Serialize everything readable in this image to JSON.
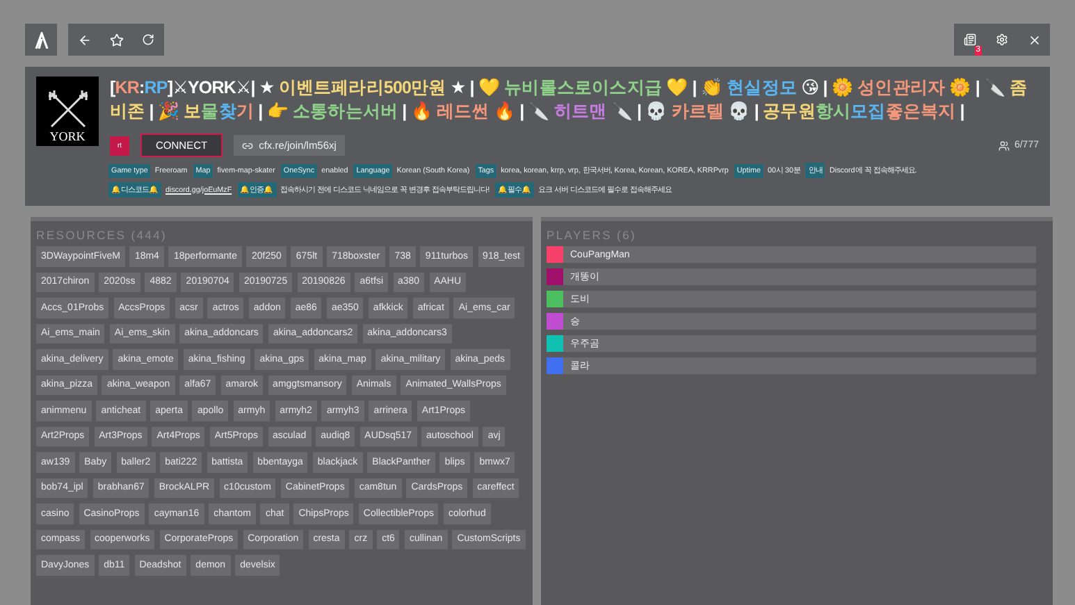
{
  "toolbar": {
    "notification_count": "3"
  },
  "server": {
    "logo_text": "YORK",
    "title": [
      {
        "text": "[",
        "color": "#ffffff"
      },
      {
        "text": "KR",
        "color": "#f4967a"
      },
      {
        "text": ":",
        "color": "#ffffff"
      },
      {
        "text": "RP",
        "color": "#5ab4f0"
      },
      {
        "text": "]⚔YORK⚔| ★ ",
        "color": "#ffffff"
      },
      {
        "text": "이벤트페라리500만원",
        "color": "#f5d77a"
      },
      {
        "text": " ★ | 💛 ",
        "color": "#ffffff"
      },
      {
        "text": "뉴비롤스로이스지급",
        "color": "#8fd18a"
      },
      {
        "text": " 💛 | 👏 ",
        "color": "#ffffff"
      },
      {
        "text": "현실정모",
        "color": "#5ab4f0"
      },
      {
        "text": " 😘 | 🌼 ",
        "color": "#ffffff"
      },
      {
        "text": "성인관리자",
        "color": "#f4967a"
      },
      {
        "text": " 🌼 | 🔪 ",
        "color": "#ffffff"
      },
      {
        "text": "좀비존",
        "color": "#f5d77a"
      },
      {
        "text": " | 🎉 ",
        "color": "#ffffff"
      },
      {
        "text": "보",
        "color": "#f5d77a"
      },
      {
        "text": "물",
        "color": "#8fd18a"
      },
      {
        "text": "찾",
        "color": "#5ab4f0"
      },
      {
        "text": "기",
        "color": "#f4967a"
      },
      {
        "text": " | 👉 ",
        "color": "#ffffff"
      },
      {
        "text": "소통하는서버",
        "color": "#8fd18a"
      },
      {
        "text": " | 🔥 ",
        "color": "#ffffff"
      },
      {
        "text": "레드썬",
        "color": "#f4967a"
      },
      {
        "text": " 🔥 | 🔪 ",
        "color": "#ffffff"
      },
      {
        "text": "히트맨",
        "color": "#c77ce0"
      },
      {
        "text": " 🔪 | 💀 ",
        "color": "#ffffff"
      },
      {
        "text": "카르텔",
        "color": "#f4967a"
      },
      {
        "text": " 💀 | ",
        "color": "#ffffff"
      },
      {
        "text": "공무원",
        "color": "#f5d77a"
      },
      {
        "text": "항시",
        "color": "#8fd18a"
      },
      {
        "text": "모집",
        "color": "#5ab4f0"
      },
      {
        "text": "좋은복지",
        "color": "#f4967a"
      },
      {
        "text": " |",
        "color": "#ffffff"
      }
    ],
    "badge": "rt",
    "connect": "CONNECT",
    "join_link": "cfx.re/join/lm56xj",
    "players_count": "6/777",
    "vars": [
      {
        "key": "Game type",
        "value": "Freeroam"
      },
      {
        "key": "Map",
        "value": "fivem-map-skater"
      },
      {
        "key": "OneSync",
        "value": "enabled"
      },
      {
        "key": "Language",
        "value": "Korean (South Korea)"
      },
      {
        "key": "Tags",
        "value": "korea, korean, krrp, vrp, 한국서버, Korea, Korean, KOREA, KRRPvrp"
      },
      {
        "key": "Uptime",
        "value": "00시 30분"
      },
      {
        "key": "안내",
        "value": "Discord에 꼭 접속해주세요."
      },
      {
        "key": "🔔디스코드🔔",
        "value": "discord.gg/joEuMzF"
      },
      {
        "key": "🔔인증🔔",
        "value": "접속하시기 전에 디스코드 닉네임으로 꼭 변경후 접속부탁드립니다!"
      },
      {
        "key": "🔔필수🔔",
        "value": "요크 서버 디스코드에 필수로 접속해주세요"
      }
    ]
  },
  "resources": {
    "title": "RESOURCES (444)",
    "items": [
      "3DWaypointFiveM",
      "18m4",
      "18performante",
      "20f250",
      "675lt",
      "718boxster",
      "738",
      "911turbos",
      "918_test",
      "2017chiron",
      "2020ss",
      "4882",
      "20190704",
      "20190725",
      "20190826",
      "a6tfsi",
      "a380",
      "AAHU",
      "Accs_01Probs",
      "AccsProps",
      "acsr",
      "actros",
      "addon",
      "ae86",
      "ae350",
      "afkkick",
      "africat",
      "Ai_ems_car",
      "Ai_ems_main",
      "Ai_ems_skin",
      "akina_addoncars",
      "akina_addoncars2",
      "akina_addoncars3",
      "akina_delivery",
      "akina_emote",
      "akina_fishing",
      "akina_gps",
      "akina_map",
      "akina_military",
      "akina_peds",
      "akina_pizza",
      "akina_weapon",
      "alfa67",
      "amarok",
      "amggtsmansory",
      "Animals",
      "Animated_WallsProps",
      "animmenu",
      "anticheat",
      "aperta",
      "apollo",
      "armyh",
      "armyh2",
      "armyh3",
      "arrinera",
      "Art1Props",
      "Art2Props",
      "Art3Props",
      "Art4Props",
      "Art5Props",
      "asculad",
      "audiq8",
      "AUDsq517",
      "autoschool",
      "avj",
      "aw139",
      "Baby",
      "baller2",
      "bati222",
      "battista",
      "bbentayga",
      "blackjack",
      "BlackPanther",
      "blips",
      "bmwx7",
      "bob74_ipl",
      "brabhan67",
      "BrockALPR",
      "c10custom",
      "CabinetProps",
      "cam8tun",
      "CardsProps",
      "careffect",
      "casino",
      "CasinoProps",
      "cayman16",
      "chantom",
      "chat",
      "ChipsProps",
      "CollectibleProps",
      "colorhud",
      "compass",
      "cooperworks",
      "CorporateProps",
      "Corporation",
      "cresta",
      "crz",
      "ct6",
      "cullinan",
      "CustomScripts",
      "DavyJones",
      "db11",
      "Deadshot",
      "demon",
      "develsix"
    ]
  },
  "players": {
    "title": "PLAYERS (6)",
    "items": [
      {
        "name": "CouPangMan",
        "color": "#f7406a"
      },
      {
        "name": "개똥이",
        "color": "#a0106a"
      },
      {
        "name": "도비",
        "color": "#4cc060"
      },
      {
        "name": "승",
        "color": "#c04cd0"
      },
      {
        "name": "우주곰",
        "color": "#10c0b0"
      },
      {
        "name": "콜라",
        "color": "#4070f0"
      }
    ]
  }
}
